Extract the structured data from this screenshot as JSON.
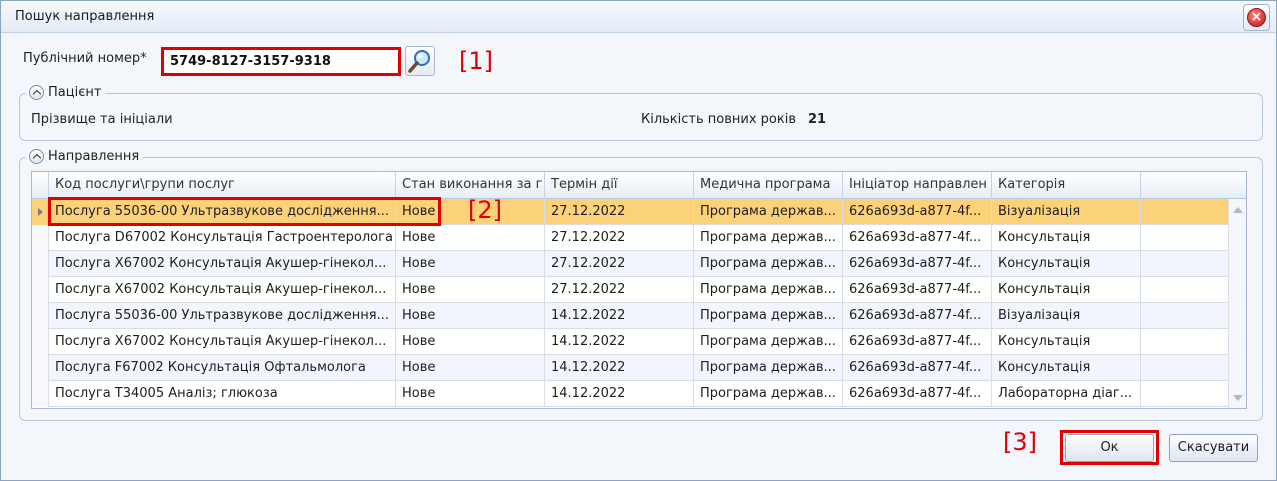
{
  "window": {
    "title": "Пошук направлення"
  },
  "search": {
    "label": "Публічний номер*",
    "value": "5749-8127-3157-9318",
    "button_icon": "magnifier-icon"
  },
  "markers": {
    "m1": "[1]",
    "m2": "[2]",
    "m3": "[3]"
  },
  "patient": {
    "group_title": "Пацієнт",
    "name_label": "Прізвище та ініціали",
    "age_label": "Кількість повних років",
    "age_value": "21"
  },
  "referrals": {
    "group_title": "Направлення",
    "columns": [
      "Код послуги\\групи послуг",
      "Стан виконання за г",
      "Термін дії",
      "Медична програма",
      "Ініціатор направлен",
      "Категорія"
    ],
    "rows": [
      {
        "service": "Послуга 55036-00 Ультразвукове дослідження...",
        "status": "Нове",
        "term": "27.12.2022",
        "program": "Програма держав...",
        "initiator": "626a693d-a877-4f...",
        "category": "Візуалізація"
      },
      {
        "service": "Послуга D67002 Консультація Гастроентеролога",
        "status": "Нове",
        "term": "27.12.2022",
        "program": "Програма держав...",
        "initiator": "626a693d-a877-4f...",
        "category": "Консультація"
      },
      {
        "service": "Послуга X67002 Консультація Акушер-гінекол...",
        "status": "Нове",
        "term": "27.12.2022",
        "program": "Програма держав...",
        "initiator": "626a693d-a877-4f...",
        "category": "Консультація"
      },
      {
        "service": "Послуга X67002 Консультація Акушер-гінекол...",
        "status": "Нове",
        "term": "27.12.2022",
        "program": "Програма держав...",
        "initiator": "626a693d-a877-4f...",
        "category": "Консультація"
      },
      {
        "service": "Послуга 55036-00 Ультразвукове дослідження...",
        "status": "Нове",
        "term": "14.12.2022",
        "program": "Програма держав...",
        "initiator": "626a693d-a877-4f...",
        "category": "Візуалізація"
      },
      {
        "service": "Послуга X67002 Консультація Акушер-гінекол...",
        "status": "Нове",
        "term": "14.12.2022",
        "program": "Програма держав...",
        "initiator": "626a693d-a877-4f...",
        "category": "Консультація"
      },
      {
        "service": "Послуга F67002 Консультація Офтальмолога",
        "status": "Нове",
        "term": "14.12.2022",
        "program": "Програма держав...",
        "initiator": "626a693d-a877-4f...",
        "category": "Консультація"
      },
      {
        "service": "Послуга T34005 Аналіз; глюкоза",
        "status": "Нове",
        "term": "14.12.2022",
        "program": "Програма держав...",
        "initiator": "626a693d-a877-4f...",
        "category": "Лабораторна діаг..."
      }
    ],
    "selected_row": 0
  },
  "buttons": {
    "ok": "Ок",
    "cancel": "Скасувати"
  },
  "colors": {
    "selection": "#fbd27a",
    "highlight": "#e00000"
  }
}
